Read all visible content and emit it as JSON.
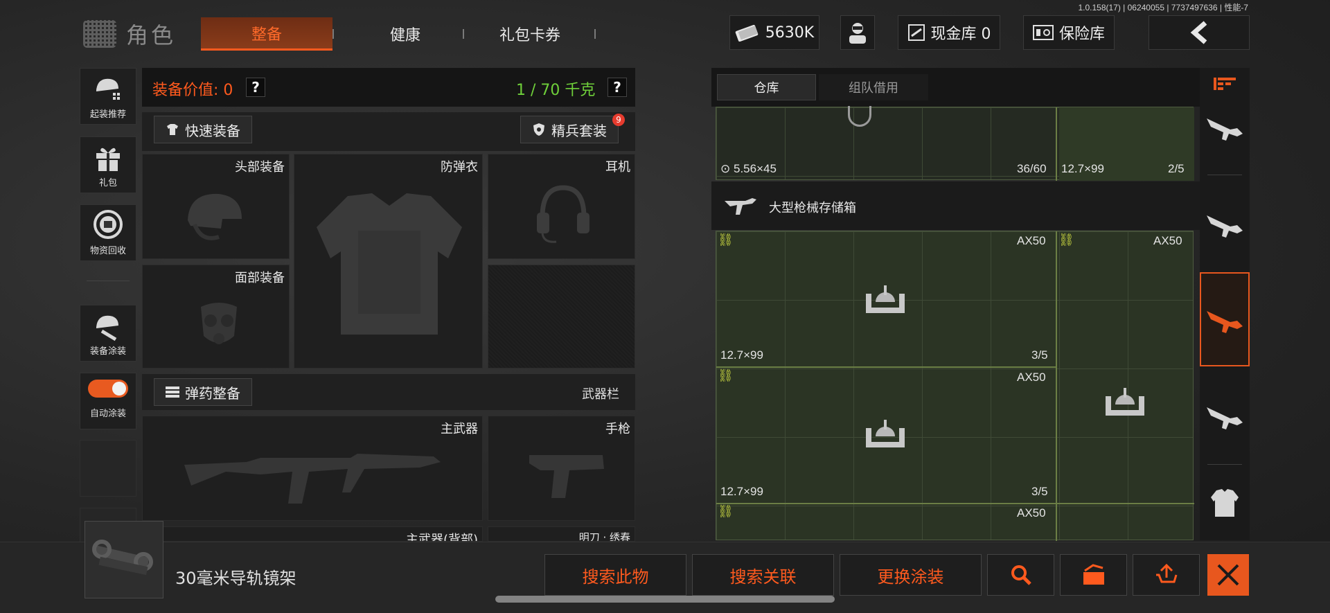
{
  "version": "1.0.158(17) | 06240055 | 7737497636 | 性能-7",
  "header": {
    "title": "角色",
    "tabs": [
      {
        "label": "整备",
        "active": true
      },
      {
        "label": "健康",
        "active": false
      },
      {
        "label": "礼包卡券",
        "active": false
      }
    ],
    "currency": "5630K",
    "cash_vault": "现金库 0",
    "safe": "保险库"
  },
  "left_rail": [
    {
      "label": "起装推荐",
      "icon": "helmet-grid-icon"
    },
    {
      "label": "礼包",
      "icon": "gift-icon"
    },
    {
      "label": "物资回收",
      "icon": "recycle-icon"
    },
    {
      "label": "装备涂装",
      "icon": "paint-helmet-icon"
    },
    {
      "label": "自动涂装",
      "icon": "toggle-icon",
      "toggle_on": true
    }
  ],
  "equipment": {
    "value_label": "装备价值: 0",
    "weight_label": "1 / 70 千克",
    "quick_equip": "快速装备",
    "elite_set": "精兵套装",
    "elite_badge": "9",
    "slots": {
      "head": "头部装备",
      "armor": "防弹衣",
      "headset": "耳机",
      "face": "面部装备"
    },
    "ammo_btn": "弹药整备",
    "weapon_bar": "武器栏",
    "primary": "主武器",
    "pistol": "手枪",
    "primary_back": "主武器(背部)",
    "melee": "明刀 · 绣春"
  },
  "storage": {
    "tabs": [
      {
        "label": "仓库",
        "active": true
      },
      {
        "label": "组队借用",
        "active": false
      }
    ],
    "top_cells": [
      {
        "ammo": "5.56×45",
        "count": "36/60"
      },
      {
        "ammo": "12.7×99",
        "count": "2/5"
      }
    ],
    "box_title": "大型枪械存储箱",
    "cells": [
      {
        "weapon": "AX50",
        "ammo": "12.7×99",
        "count": "3/5"
      },
      {
        "weapon": "AX50"
      },
      {
        "weapon": "AX50",
        "ammo": "12.7×99",
        "count": "3/5"
      },
      {
        "weapon": "AX50"
      }
    ]
  },
  "selected_item": {
    "name": "30毫米导轨镜架"
  },
  "actions": {
    "search_item": "搜索此物",
    "search_related": "搜索关联",
    "change_skin": "更换涂装"
  },
  "colors": {
    "accent": "#ff5a1e",
    "weight_ok": "#6fd03a",
    "grid_bg": "#2b3424"
  }
}
